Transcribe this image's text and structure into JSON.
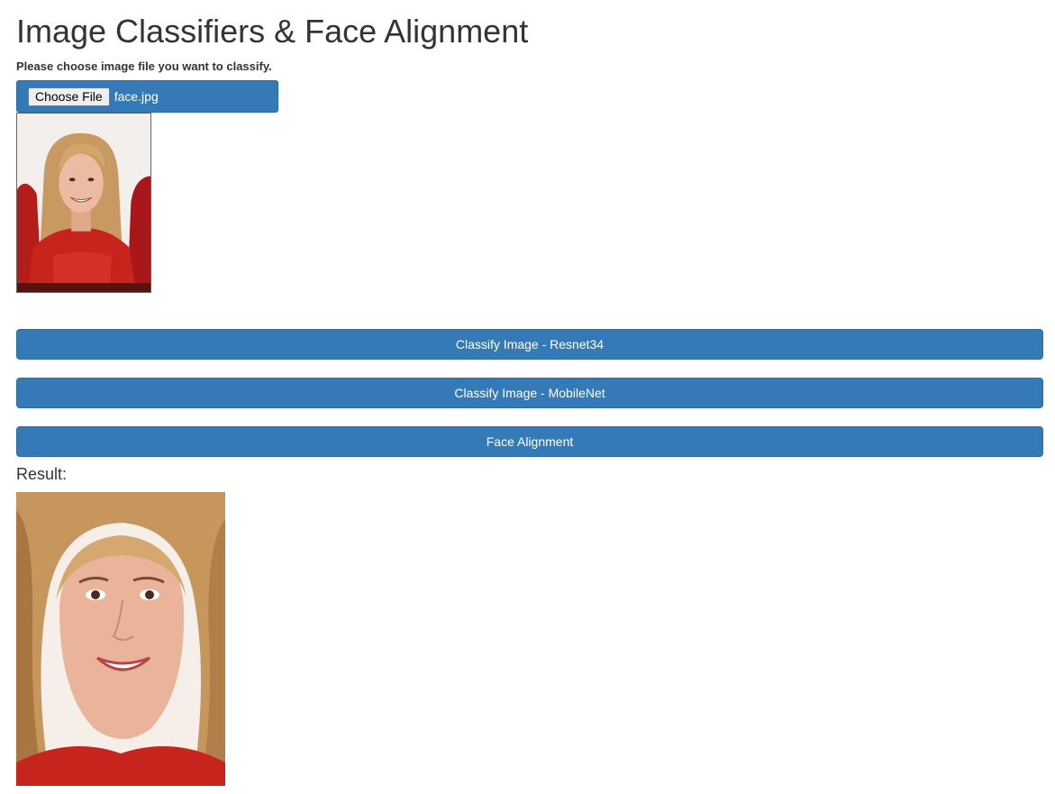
{
  "page": {
    "title": "Image Classifiers & Face Alignment",
    "instruction": "Please choose image file you want to classify."
  },
  "file_input": {
    "button_label": "Choose File",
    "file_name": "face.jpg"
  },
  "buttons": {
    "resnet_label": "Classify Image - Resnet34",
    "mobilenet_label": "Classify Image - MobileNet",
    "face_alignment_label": "Face Alignment"
  },
  "result": {
    "label": "Result:"
  },
  "colors": {
    "primary": "#337ab7",
    "primary_border": "#2e6da4",
    "text": "#333333",
    "photo_red": "#c8241e",
    "photo_hair": "#c89a62"
  }
}
